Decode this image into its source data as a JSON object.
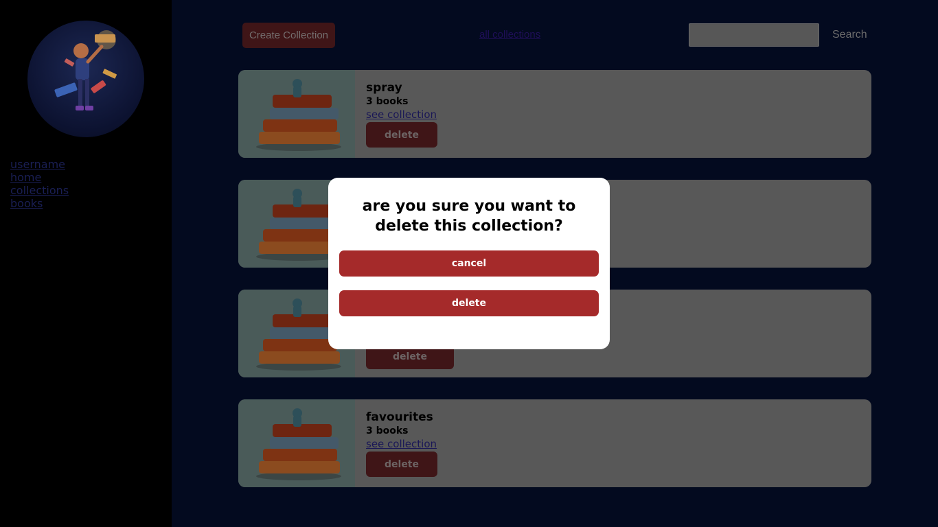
{
  "sidebar": {
    "nav": [
      "username",
      "home",
      "collections",
      "books"
    ]
  },
  "topbar": {
    "create_label": "Create Collection",
    "all_link": "all collections",
    "search_value": "",
    "search_label": "Search"
  },
  "cards": [
    {
      "title": "spray",
      "count": "3 books",
      "link": "see collection",
      "delete": "delete"
    },
    {
      "title": "",
      "count": "",
      "link": "",
      "delete": ""
    },
    {
      "title": "",
      "count": "",
      "link": "",
      "delete": "delete"
    },
    {
      "title": "favourites",
      "count": "3 books",
      "link": "see collection",
      "delete": "delete"
    }
  ],
  "modal": {
    "question": "are you sure you want to delete this collection?",
    "cancel": "cancel",
    "delete": "delete"
  },
  "colors": {
    "modal_button": "#a52a2a",
    "page_bg": "#030a1f"
  }
}
